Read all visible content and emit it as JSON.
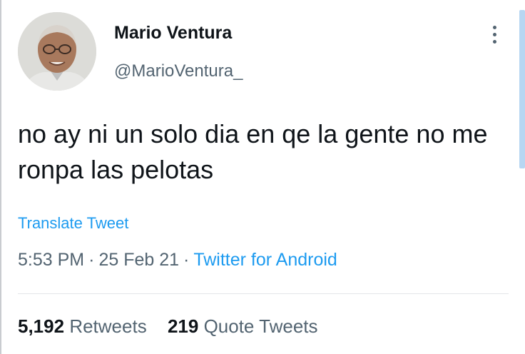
{
  "user": {
    "display_name": "Mario Ventura",
    "handle": "@MarioVentura_"
  },
  "tweet": {
    "text": "no ay ni un solo dia en qe la gente no me ronpa las pelotas",
    "translate_label": "Translate Tweet",
    "time": "5:53 PM",
    "date": "25 Feb 21",
    "separator": "·",
    "source": "Twitter for Android"
  },
  "stats": {
    "retweets_count": "5,192",
    "retweets_label": "Retweets",
    "quotes_count": "219",
    "quotes_label": "Quote Tweets"
  },
  "icons": {
    "more": "more-vertical-icon",
    "avatar": "profile-photo"
  },
  "colors": {
    "link": "#1d9bf0",
    "primary_text": "#0f1419",
    "secondary_text": "#536471"
  }
}
